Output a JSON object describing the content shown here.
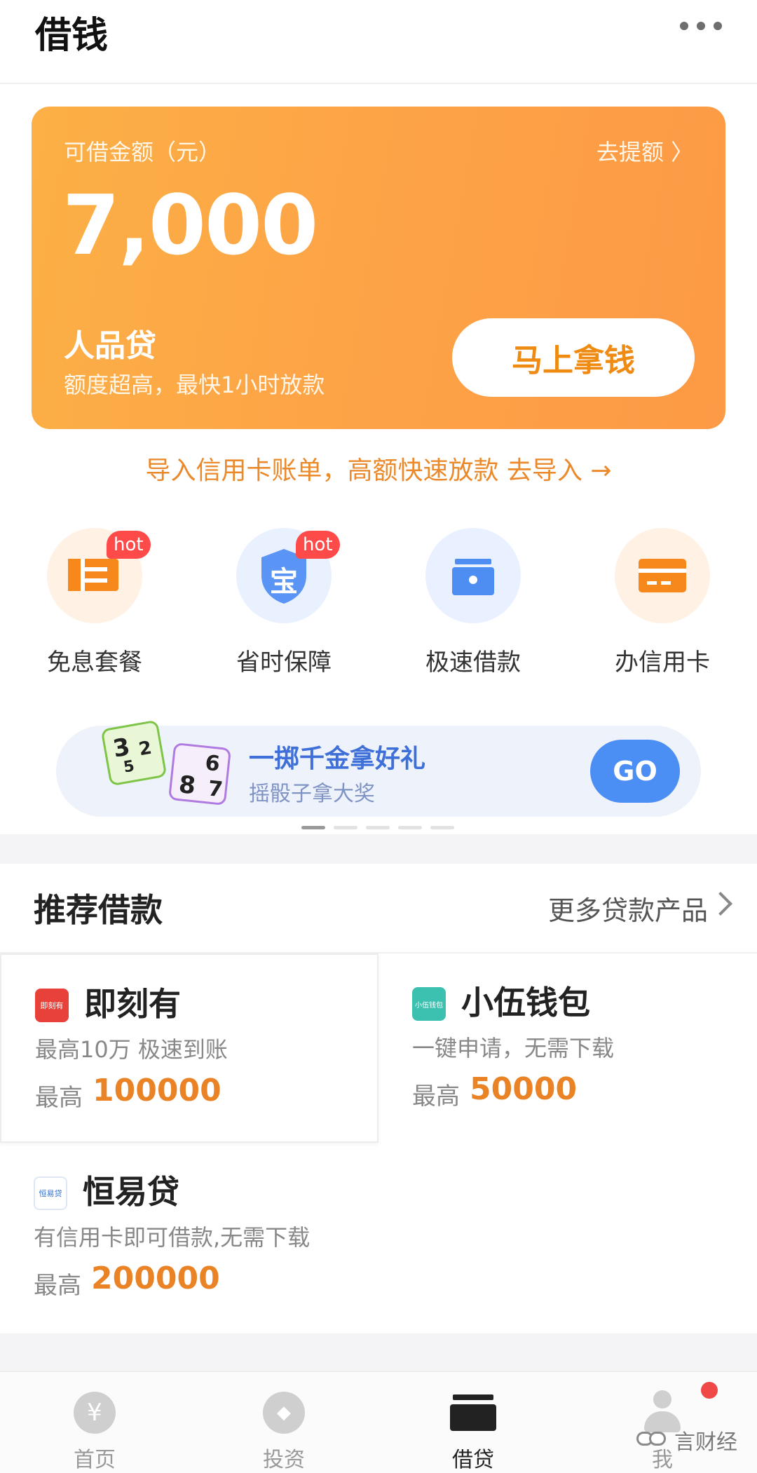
{
  "header": {
    "title": "借钱"
  },
  "loan_card": {
    "label": "可借金额（元）",
    "raise_link": "去提额 〉",
    "amount": "7,000",
    "product_name": "人品贷",
    "product_desc": "额度超高，最快1小时放款",
    "cta": "马上拿钱"
  },
  "import_link": "导入信用卡账单，高额快速放款  去导入 →",
  "quick_actions": [
    {
      "label": "免息套餐",
      "badge": "hot",
      "icon": "wallet-icon"
    },
    {
      "label": "省时保障",
      "badge": "hot",
      "icon": "shield-icon",
      "icon_text": "宝"
    },
    {
      "label": "极速借款",
      "icon": "folder-icon"
    },
    {
      "label": "办信用卡",
      "icon": "card-icon"
    }
  ],
  "banner": {
    "title": "一掷千金拿好礼",
    "subtitle": "摇骰子拿大奖",
    "go": "GO",
    "dice1": {
      "front": "3",
      "top": "2",
      "side": "5"
    },
    "dice2": {
      "front": "8",
      "top": "6",
      "side": "7"
    }
  },
  "recommend": {
    "title": "推荐借款",
    "more": "更多贷款产品",
    "max_label": "最高",
    "products": [
      {
        "name": "即刻有",
        "desc": "最高10万 极速到账",
        "max": "100000",
        "logo_text": "即刻有",
        "logo_color": "#e8413a"
      },
      {
        "name": "小伍钱包",
        "desc": "一键申请，无需下载",
        "max": "50000",
        "logo_text": "小伍钱包",
        "logo_color": "#3cc1b1"
      },
      {
        "name": "恒易贷",
        "desc": "有信用卡即可借款,无需下载",
        "max": "200000",
        "logo_text": "恒易贷",
        "logo_color": "#2a6fd1"
      }
    ]
  },
  "tabbar": {
    "tabs": [
      {
        "label": "首页",
        "icon_text": "¥"
      },
      {
        "label": "投资",
        "icon_text": "◆"
      },
      {
        "label": "借贷"
      },
      {
        "label": "我"
      }
    ]
  },
  "watermark": "言财经",
  "colors": {
    "accent": "#fda447",
    "link": "#ea8a2c",
    "value": "#e98325",
    "go": "#4b8ef4"
  }
}
